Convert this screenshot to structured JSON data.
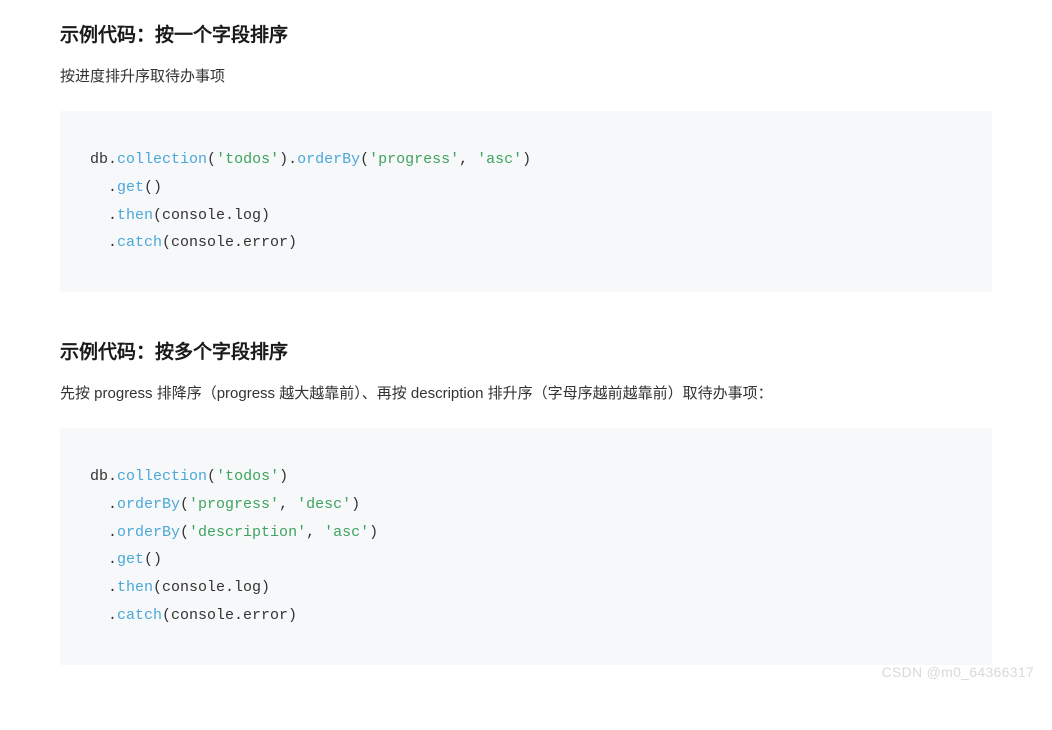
{
  "section1": {
    "title": "示例代码：按一个字段排序",
    "desc": "按进度排升序取待办事项",
    "code": {
      "tokens": [
        {
          "t": "db",
          "c": "plain"
        },
        {
          "t": ".",
          "c": "punct"
        },
        {
          "t": "collection",
          "c": "method"
        },
        {
          "t": "(",
          "c": "punct"
        },
        {
          "t": "'todos'",
          "c": "string"
        },
        {
          "t": ").",
          "c": "punct"
        },
        {
          "t": "orderBy",
          "c": "method"
        },
        {
          "t": "(",
          "c": "punct"
        },
        {
          "t": "'progress'",
          "c": "string"
        },
        {
          "t": ", ",
          "c": "punct"
        },
        {
          "t": "'asc'",
          "c": "string"
        },
        {
          "t": ")",
          "c": "punct"
        },
        {
          "t": "\n  .",
          "c": "punct"
        },
        {
          "t": "get",
          "c": "method"
        },
        {
          "t": "()",
          "c": "punct"
        },
        {
          "t": "\n  .",
          "c": "punct"
        },
        {
          "t": "then",
          "c": "method"
        },
        {
          "t": "(console.log)",
          "c": "plain"
        },
        {
          "t": "\n  .",
          "c": "punct"
        },
        {
          "t": "catch",
          "c": "method"
        },
        {
          "t": "(console.error)",
          "c": "plain"
        }
      ]
    }
  },
  "section2": {
    "title": "示例代码：按多个字段排序",
    "desc": "先按 progress 排降序（progress 越大越靠前）、再按 description 排升序（字母序越前越靠前）取待办事项：",
    "code": {
      "tokens": [
        {
          "t": "db",
          "c": "plain"
        },
        {
          "t": ".",
          "c": "punct"
        },
        {
          "t": "collection",
          "c": "method"
        },
        {
          "t": "(",
          "c": "punct"
        },
        {
          "t": "'todos'",
          "c": "string"
        },
        {
          "t": ")",
          "c": "punct"
        },
        {
          "t": "\n  .",
          "c": "punct"
        },
        {
          "t": "orderBy",
          "c": "method"
        },
        {
          "t": "(",
          "c": "punct"
        },
        {
          "t": "'progress'",
          "c": "string"
        },
        {
          "t": ", ",
          "c": "punct"
        },
        {
          "t": "'desc'",
          "c": "string"
        },
        {
          "t": ")",
          "c": "punct"
        },
        {
          "t": "\n  .",
          "c": "punct"
        },
        {
          "t": "orderBy",
          "c": "method"
        },
        {
          "t": "(",
          "c": "punct"
        },
        {
          "t": "'description'",
          "c": "string"
        },
        {
          "t": ", ",
          "c": "punct"
        },
        {
          "t": "'asc'",
          "c": "string"
        },
        {
          "t": ")",
          "c": "punct"
        },
        {
          "t": "\n  .",
          "c": "punct"
        },
        {
          "t": "get",
          "c": "method"
        },
        {
          "t": "()",
          "c": "punct"
        },
        {
          "t": "\n  .",
          "c": "punct"
        },
        {
          "t": "then",
          "c": "method"
        },
        {
          "t": "(console.log)",
          "c": "plain"
        },
        {
          "t": "\n  .",
          "c": "punct"
        },
        {
          "t": "catch",
          "c": "method"
        },
        {
          "t": "(console.error)",
          "c": "plain"
        }
      ]
    }
  },
  "watermark": "CSDN @m0_64366317"
}
